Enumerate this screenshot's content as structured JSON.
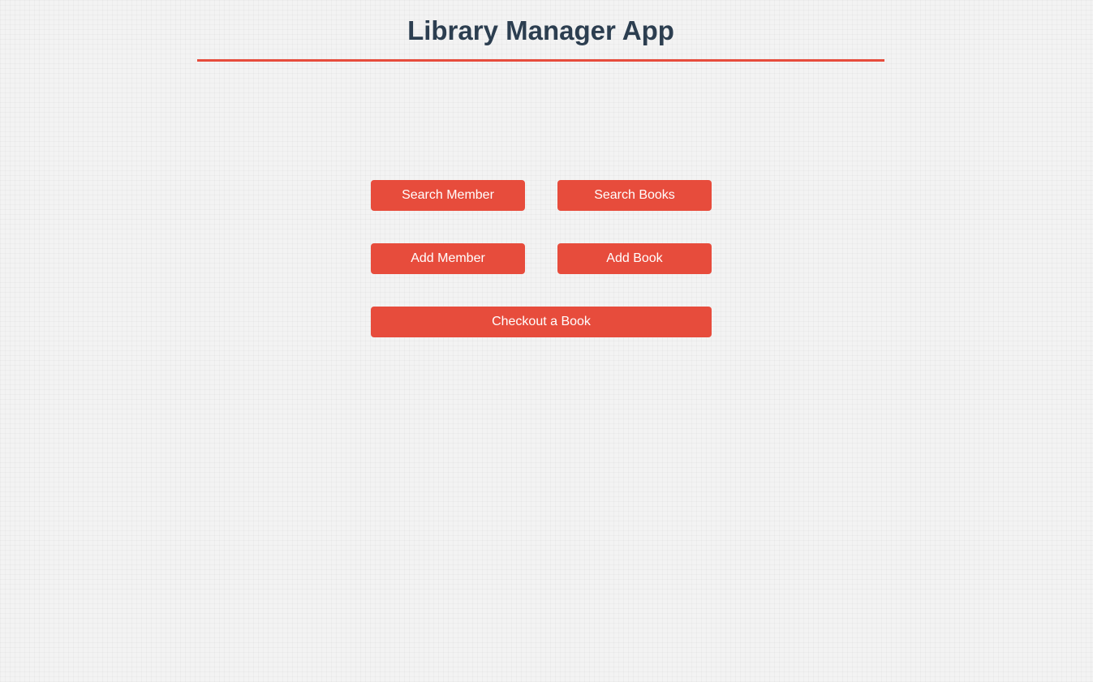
{
  "app": {
    "title": "Library Manager App"
  },
  "menu": {
    "search_member_label": "Search Member",
    "search_books_label": "Search Books",
    "add_member_label": "Add Member",
    "add_book_label": "Add Book",
    "checkout_book_label": "Checkout a Book"
  },
  "colors": {
    "accent": "#e74c3c",
    "title_text": "#2c3e50",
    "button_text": "#ffffff",
    "background": "#f3f3f3"
  }
}
